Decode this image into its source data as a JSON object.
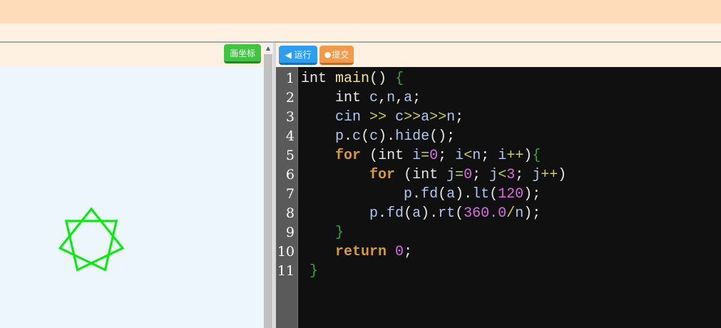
{
  "toolbar": {
    "draw_coords_label": "画坐标",
    "run_label": "◀ 运行",
    "submit_label": "提交"
  },
  "canvas": {
    "star_color": "#00ee00",
    "background": "#edf5fd"
  },
  "editor": {
    "line_numbers": [
      "1",
      "2",
      "3",
      "4",
      "5",
      "6",
      "7",
      "8",
      "9",
      "10",
      "11"
    ],
    "lines": [
      "int main() {",
      "    int c,n,a;",
      "    cin >> c>>a>>n;",
      "    p.c(c).hide();",
      "    for (int i=0; i<n; i++){",
      "        for (int j=0; j<3; j++)",
      "            p.fd(a).lt(120);",
      "        p.fd(a).rt(360.0/n);",
      "    }",
      "    return 0;",
      " }"
    ]
  },
  "colors": {
    "topbar": "#ffdcb9",
    "run": "#2b9df2",
    "submit": "#f39a4a",
    "coords": "#3fc53f"
  }
}
